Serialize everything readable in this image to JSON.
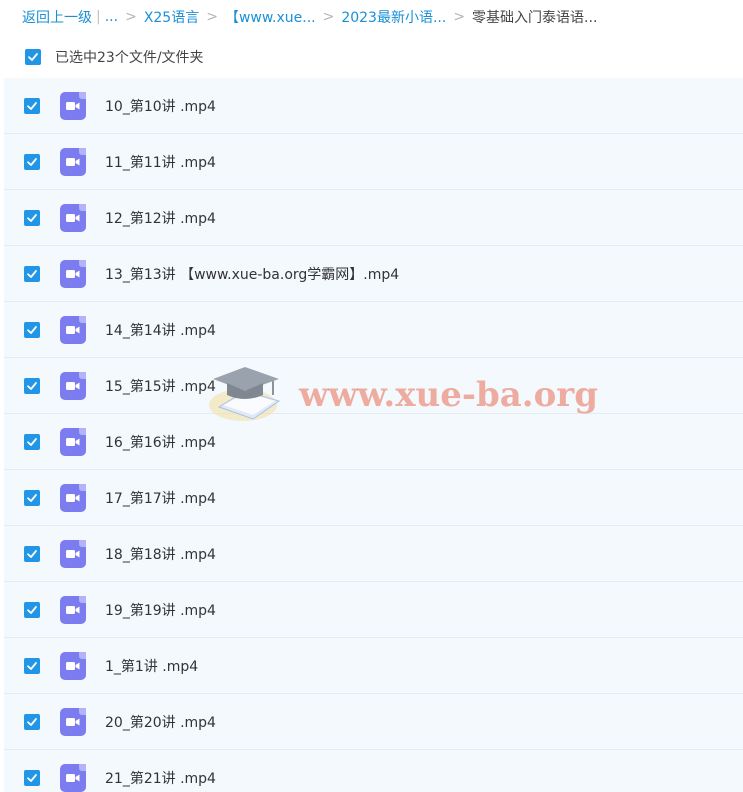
{
  "breadcrumb": {
    "back_label": "返回上一级",
    "ellipsis": "...",
    "items": [
      "X25语言",
      "【www.xue...",
      "2023最新小语...",
      "零基础入门泰语语..."
    ],
    "separator": ">",
    "bar": "|"
  },
  "selection": {
    "text": "已选中23个文件/文件夹"
  },
  "files": [
    {
      "name": "10_第10讲 .mp4"
    },
    {
      "name": "11_第11讲 .mp4"
    },
    {
      "name": "12_第12讲 .mp4"
    },
    {
      "name": "13_第13讲 【www.xue-ba.org学霸网】.mp4"
    },
    {
      "name": "14_第14讲 .mp4"
    },
    {
      "name": "15_第15讲 .mp4"
    },
    {
      "name": "16_第16讲 .mp4"
    },
    {
      "name": "17_第17讲 .mp4"
    },
    {
      "name": "18_第18讲 .mp4"
    },
    {
      "name": "19_第19讲 .mp4"
    },
    {
      "name": "1_第1讲 .mp4"
    },
    {
      "name": "20_第20讲 .mp4"
    },
    {
      "name": "21_第21讲 .mp4"
    }
  ],
  "watermark": {
    "text": "www.xue-ba.org"
  },
  "colors": {
    "link": "#1a8fd8",
    "checkbox": "#2196e6",
    "video_icon": "#7b7cf0",
    "list_bg": "#f4f9fe"
  },
  "icons": {
    "checkbox": "check-icon",
    "file": "video-file-icon",
    "watermark_logo": "graduation-cap-icon"
  }
}
